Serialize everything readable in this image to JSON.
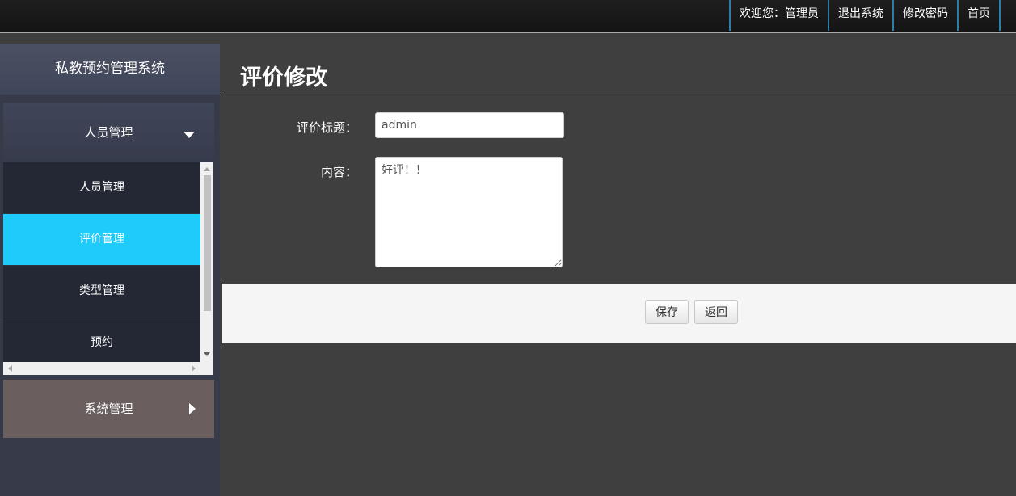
{
  "topnav": {
    "welcome": "欢迎您：管理员",
    "logout": "退出系统",
    "change_password": "修改密码",
    "home": "首页"
  },
  "sidebar": {
    "title": "私教预约管理系统",
    "groups": [
      {
        "label": "人员管理",
        "expanded": true,
        "items": [
          {
            "label": "人员管理",
            "active": false
          },
          {
            "label": "评价管理",
            "active": true
          },
          {
            "label": "类型管理",
            "active": false
          },
          {
            "label": "预约",
            "active": false
          }
        ]
      },
      {
        "label": "系统管理",
        "expanded": false
      }
    ]
  },
  "main": {
    "page_title": "评价修改",
    "form": {
      "title_label": "评价标题：",
      "title_value": "admin",
      "content_label": "内容：",
      "content_value": "好评！！"
    },
    "buttons": {
      "save": "保存",
      "back": "返回"
    }
  },
  "colors": {
    "active_item": "#1ecbfa",
    "nav_divider": "#2a7fa6",
    "main_bg": "#3f3f3f"
  }
}
